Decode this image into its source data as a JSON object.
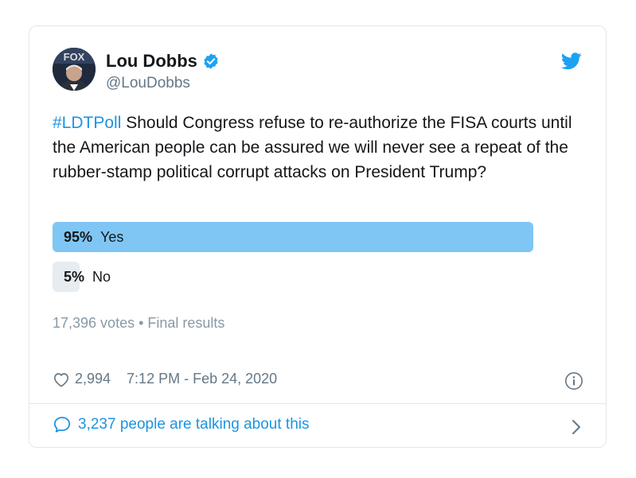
{
  "tweet": {
    "author": {
      "display_name": "Lou Dobbs",
      "handle": "@LouDobbs",
      "verified": true,
      "avatar_icon": "profile-photo",
      "avatar_text": "FOX"
    },
    "hashtag": "#LDTPoll",
    "text": " Should Congress refuse to re-authorize the FISA courts until the American people can be assured we will never see a repeat of the rubber-stamp political corrupt attacks on President Trump?",
    "poll": {
      "options": [
        {
          "percent_label": "95%",
          "label": "Yes",
          "fraction": 0.95,
          "winner": true
        },
        {
          "percent_label": "5%",
          "label": "No",
          "fraction": 0.05,
          "winner": false
        }
      ],
      "summary": "17,396 votes • Final results"
    },
    "likes": "2,994",
    "timestamp": "7:12 PM - Feb 24, 2020",
    "talking": "3,237 people are talking about this"
  },
  "colors": {
    "accent": "#1b95e0",
    "poll_winner": "#7fc6f4",
    "poll_loser": "#e6ecf0",
    "verified_badge": "#1da1f2"
  },
  "icons": {
    "logo": "twitter-bird-icon",
    "verified": "verified-badge-icon",
    "like": "heart-icon",
    "info": "info-icon",
    "reply": "speech-bubble-icon",
    "chevron": "chevron-right-icon"
  }
}
